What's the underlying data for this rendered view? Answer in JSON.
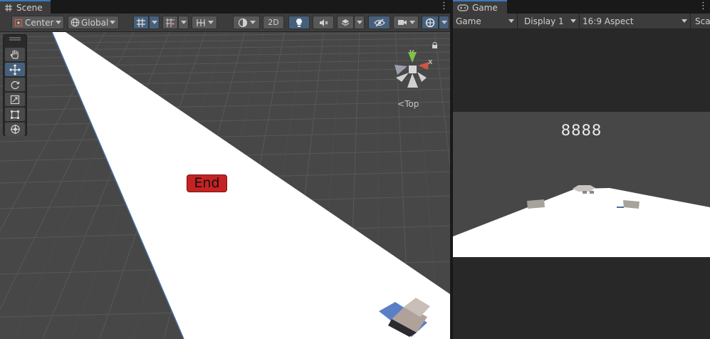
{
  "scene": {
    "tab_label": "Scene",
    "pivot_mode": "Center",
    "pivot_rotation": "Global",
    "mode_2d_label": "2D",
    "orientation_label": "Top",
    "colors": {
      "accent": "#3a79bb",
      "active_button": "#46607c",
      "grid_background": "#474747",
      "road": "#ffffff",
      "end_button": "#c52323"
    }
  },
  "scene_objects": {
    "end_button_label": "End"
  },
  "tools": [
    "hand-tool",
    "move-tool",
    "rotate-tool",
    "scale-tool",
    "rect-tool",
    "transform-tool"
  ],
  "game": {
    "tab_label": "Game",
    "view_mode": "Game",
    "display": "Display 1",
    "aspect": "16:9 Aspect",
    "scale_label": "Sca",
    "score": "8888"
  }
}
